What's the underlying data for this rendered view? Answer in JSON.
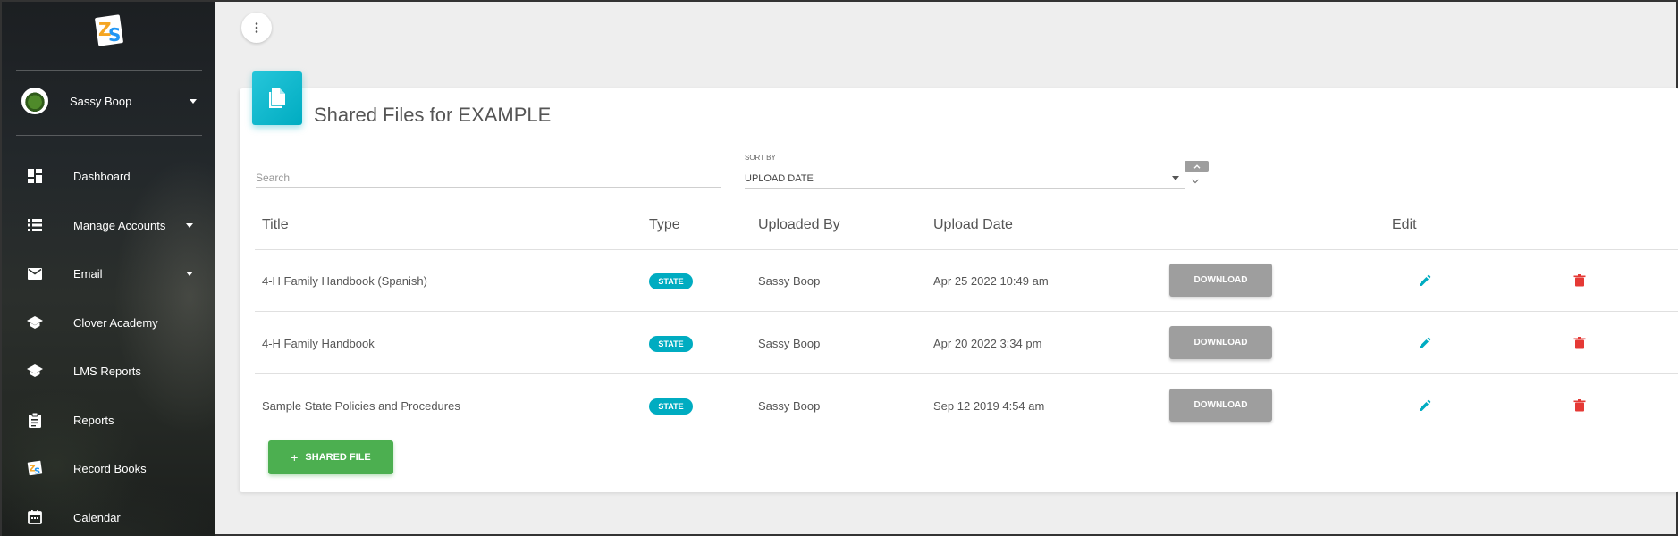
{
  "sidebar": {
    "user_name": "Sassy Boop",
    "items": [
      {
        "label": "Dashboard",
        "icon": "dashboard-icon"
      },
      {
        "label": "Manage Accounts",
        "icon": "list-icon",
        "has_caret": true
      },
      {
        "label": "Email",
        "icon": "mail-icon",
        "has_caret": true
      },
      {
        "label": "Clover Academy",
        "icon": "school-icon"
      },
      {
        "label": "LMS Reports",
        "icon": "school-icon"
      },
      {
        "label": "Reports",
        "icon": "clipboard-icon"
      },
      {
        "label": "Record Books",
        "icon": "zs-logo-icon"
      },
      {
        "label": "Calendar",
        "icon": "calendar-icon"
      }
    ]
  },
  "main": {
    "title": "Shared Files for EXAMPLE",
    "search_placeholder": "Search",
    "sort": {
      "label": "SORT BY",
      "value": "UPLOAD DATE"
    },
    "columns": {
      "title": "Title",
      "type": "Type",
      "uploaded_by": "Uploaded By",
      "upload_date": "Upload Date",
      "edit": "Edit"
    },
    "rows": [
      {
        "title": "4-H Family Handbook (Spanish)",
        "type": "STATE",
        "uploaded_by": "Sassy Boop",
        "upload_date": "Apr 25 2022 10:49 am",
        "download": "DOWNLOAD"
      },
      {
        "title": "4-H Family Handbook",
        "type": "STATE",
        "uploaded_by": "Sassy Boop",
        "upload_date": "Apr 20 2022 3:34 pm",
        "download": "DOWNLOAD"
      },
      {
        "title": "Sample State Policies and Procedures",
        "type": "STATE",
        "uploaded_by": "Sassy Boop",
        "upload_date": "Sep 12 2019 4:54 am",
        "download": "DOWNLOAD"
      }
    ],
    "add_button": "SHARED FILE"
  },
  "colors": {
    "accent": "#00acc1",
    "success": "#4caf50",
    "danger": "#e53935",
    "neutral_button": "#9e9e9e"
  }
}
